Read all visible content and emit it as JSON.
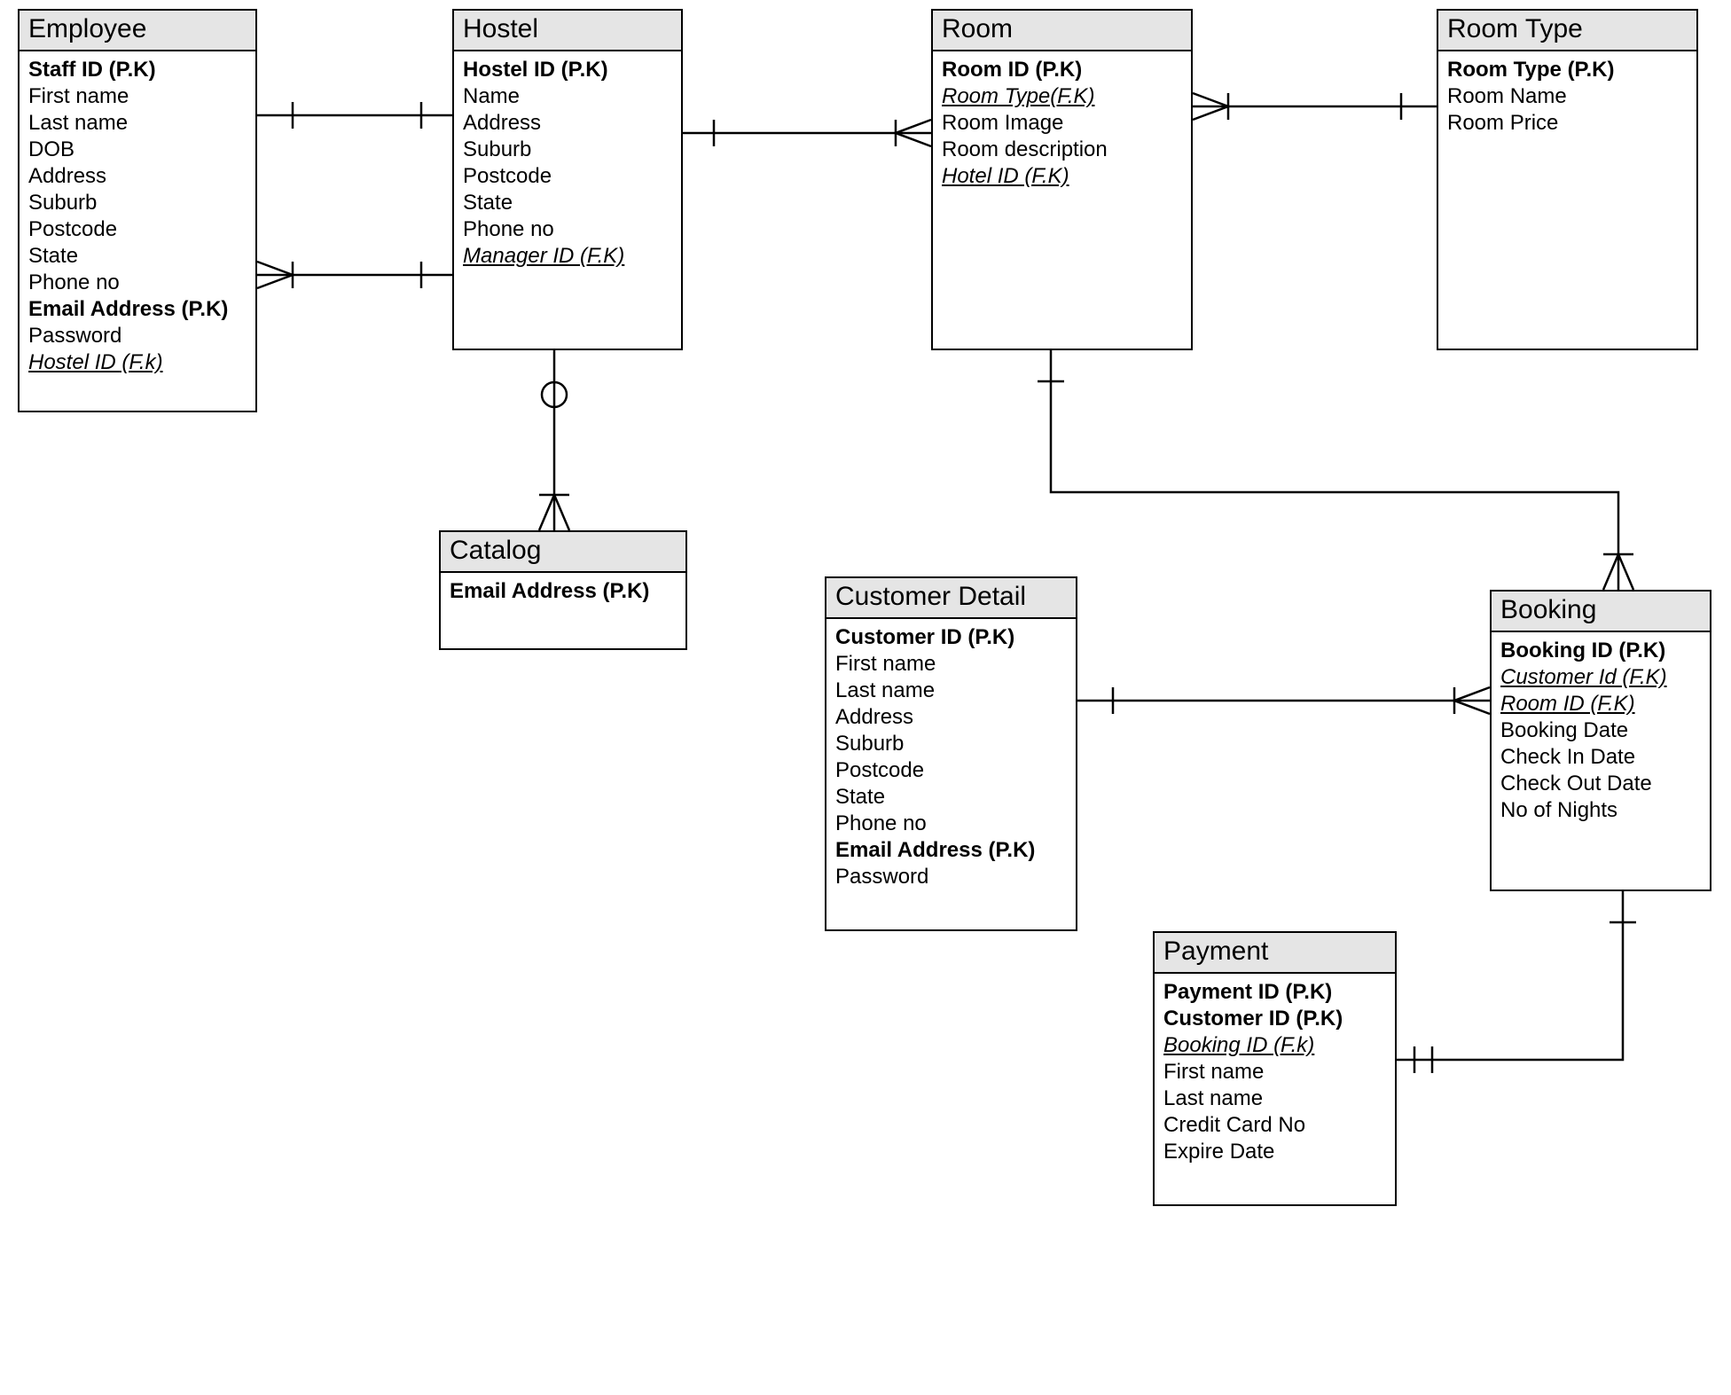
{
  "entities": {
    "employee": {
      "title": "Employee",
      "attrs": [
        {
          "t": "Staff ID (P.K)",
          "pk": true
        },
        {
          "t": "First name"
        },
        {
          "t": "Last name"
        },
        {
          "t": "DOB"
        },
        {
          "t": "Address"
        },
        {
          "t": "Suburb"
        },
        {
          "t": "Postcode"
        },
        {
          "t": "State"
        },
        {
          "t": "Phone no"
        },
        {
          "t": "Email Address (P.K)",
          "pk": true
        },
        {
          "t": "Password"
        },
        {
          "t": "Hostel ID (F.k)",
          "fk": true
        }
      ]
    },
    "hostel": {
      "title": "Hostel",
      "attrs": [
        {
          "t": "Hostel ID (P.K)",
          "pk": true
        },
        {
          "t": "Name"
        },
        {
          "t": "Address"
        },
        {
          "t": "Suburb"
        },
        {
          "t": "Postcode"
        },
        {
          "t": "State"
        },
        {
          "t": "Phone no"
        },
        {
          "t": "Manager ID (F.K)",
          "fk": true
        }
      ]
    },
    "catalog": {
      "title": "Catalog",
      "attrs": [
        {
          "t": "Email Address (P.K)",
          "pk": true
        }
      ]
    },
    "room": {
      "title": "Room",
      "attrs": [
        {
          "t": "Room ID (P.K)",
          "pk": true
        },
        {
          "t": "Room Type(F.K)",
          "fk": true
        },
        {
          "t": "Room Image"
        },
        {
          "t": "Room description"
        },
        {
          "t": "Hotel  ID (F.K)",
          "fk": true
        }
      ]
    },
    "roomtype": {
      "title": "Room Type",
      "attrs": [
        {
          "t": "Room Type (P.K)",
          "pk": true
        },
        {
          "t": "Room Name"
        },
        {
          "t": "Room Price"
        }
      ]
    },
    "customer": {
      "title": "Customer Detail",
      "attrs": [
        {
          "t": "Customer ID (P.K)",
          "pk": true
        },
        {
          "t": "First name"
        },
        {
          "t": "Last name"
        },
        {
          "t": "Address"
        },
        {
          "t": "Suburb"
        },
        {
          "t": "Postcode"
        },
        {
          "t": "State"
        },
        {
          "t": "Phone no"
        },
        {
          "t": "Email Address (P.K)",
          "pk": true
        },
        {
          "t": "Password"
        }
      ]
    },
    "booking": {
      "title": "Booking",
      "attrs": [
        {
          "t": "Booking ID (P.K)",
          "pk": true
        },
        {
          "t": "Customer Id (F.K)",
          "fk": true
        },
        {
          "t": "Room ID (F.K)",
          "fk": true
        },
        {
          "t": "Booking Date"
        },
        {
          "t": "Check In Date"
        },
        {
          "t": "Check Out Date"
        },
        {
          "t": "No of Nights"
        }
      ]
    },
    "payment": {
      "title": "Payment",
      "attrs": [
        {
          "t": "Payment ID (P.K)",
          "pk": true
        },
        {
          "t": "Customer ID (P.K)",
          "pk": true
        },
        {
          "t": "Booking ID (F.k)",
          "fk": true
        },
        {
          "t": "First name"
        },
        {
          "t": "Last name"
        },
        {
          "t": "Credit Card No"
        },
        {
          "t": "Expire Date"
        }
      ]
    }
  }
}
